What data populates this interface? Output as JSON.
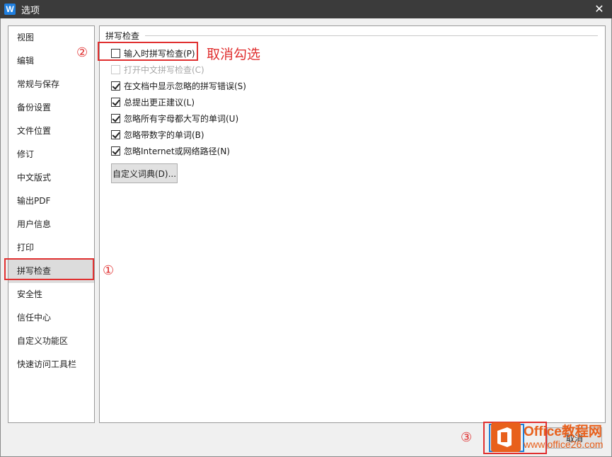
{
  "window": {
    "title": "选项",
    "close_glyph": "✕",
    "app_icon": "W"
  },
  "sidebar": {
    "items": [
      {
        "label": "视图"
      },
      {
        "label": "编辑"
      },
      {
        "label": "常规与保存"
      },
      {
        "label": "备份设置"
      },
      {
        "label": "文件位置"
      },
      {
        "label": "修订"
      },
      {
        "label": "中文版式"
      },
      {
        "label": "输出PDF"
      },
      {
        "label": "用户信息"
      },
      {
        "label": "打印"
      },
      {
        "label": "拼写检查"
      },
      {
        "label": "安全性"
      },
      {
        "label": "信任中心"
      },
      {
        "label": "自定义功能区"
      },
      {
        "label": "快速访问工具栏"
      }
    ],
    "selected": "拼写检查"
  },
  "spell": {
    "group_title": "拼写检查",
    "options": [
      {
        "label": "输入时拼写检查(P)",
        "checked": false,
        "enabled": true
      },
      {
        "label": "打开中文拼写检查(C)",
        "checked": false,
        "enabled": false
      },
      {
        "label": "在文档中显示忽略的拼写错误(S)",
        "checked": true,
        "enabled": true
      },
      {
        "label": "总提出更正建议(L)",
        "checked": true,
        "enabled": true
      },
      {
        "label": "忽略所有字母都大写的单词(U)",
        "checked": true,
        "enabled": true
      },
      {
        "label": "忽略带数字的单词(B)",
        "checked": true,
        "enabled": true
      },
      {
        "label": "忽略Internet或网络路径(N)",
        "checked": true,
        "enabled": true
      }
    ],
    "dict_button": "自定义词典(D)..."
  },
  "annotations": {
    "step1": "①",
    "step2": "②",
    "step3": "③",
    "note": "取消勾选",
    "color": "#e03030"
  },
  "footer": {
    "ok_label": "",
    "cancel_label": "取消"
  },
  "watermark": {
    "brand": "Office教程网",
    "site": "www.office26.com"
  }
}
